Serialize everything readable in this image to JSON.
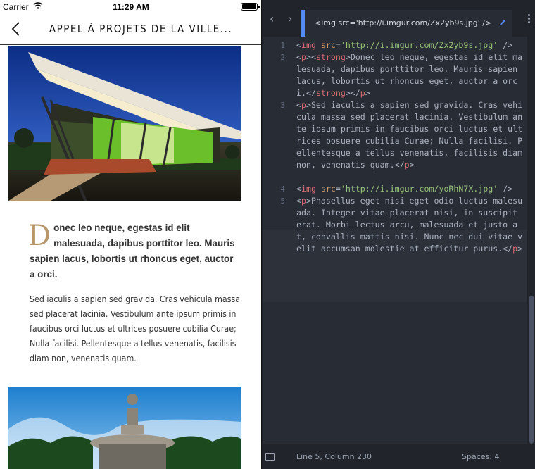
{
  "status_bar": {
    "carrier": "Carrier",
    "time": "11:29 AM"
  },
  "nav": {
    "title": "APPEL À PROJETS DE LA VILLE..."
  },
  "article": {
    "lead_first_letter": "D",
    "lead_rest": "onec leo neque, egestas id elit malesuada, dapibus porttitor leo. Mauris sapien lacus, lobortis ut rhoncus eget, auctor a orci.",
    "body": "Sed iaculis a sapien sed gravida. Cras vehicula massa sed placerat lacinia. Vestibulum ante ipsum primis in faucibus orci luctus et ultrices posuere cubilia Curae; Nulla facilisi. Pellentesque a tellus venenatis, facilisis diam non, venenatis quam."
  },
  "editor": {
    "tab_label": "<img src='http://i.imgur.com/Zx2yb9s.jpg' />",
    "lines": [
      {
        "num": "1"
      },
      {
        "num": "2"
      },
      {
        "num": "3"
      },
      {
        "num": "4"
      },
      {
        "num": "5"
      }
    ],
    "code": {
      "l1_src": "'http://i.imgur.com/Zx2yb9s.jpg'",
      "l2_text": "Donec leo neque, egestas id elit malesuada, dapibus porttitor leo. Mauris sapien lacus, lobortis ut rhoncus eget, auctor a orci.",
      "l3_text": "Sed iaculis a sapien sed gravida. Cras vehicula massa sed placerat lacinia. Vestibulum ante ipsum primis in faucibus orci luctus et ultrices posuere cubilia Curae; Nulla facilisi. Pellentesque a tellus venenatis, facilisis diam non, venenatis quam.",
      "l4_src": "'http://i.imgur.com/yoRhN7X.jpg'",
      "l5_text": "Phasellus eget nisi eget odio luctus malesuada. Integer vitae placerat nisi, in suscipit erat. Morbi lectus arcu, malesuada et justo at, convallis mattis nisi. Nunc nec dui vitae velit accumsan molestie at efficitur purus."
    },
    "cursor_position": "Line 5, Column 230",
    "indentation": "Spaces: 4"
  },
  "colors": {
    "accent": "#568af2",
    "drop_cap": "#b7966a",
    "tag": "#e06c75",
    "attr": "#d19a66",
    "string": "#98c379"
  }
}
